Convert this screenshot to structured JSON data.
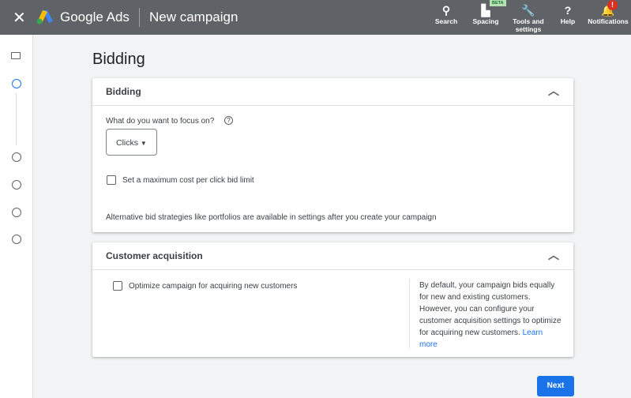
{
  "header": {
    "close": "✕",
    "brand": "Google Ads",
    "title": "New campaign",
    "tools": [
      {
        "label": "Search",
        "icon": "⚲"
      },
      {
        "label": "Spacing",
        "icon": "▙"
      },
      {
        "label": "Tools and settings",
        "icon": "🔧"
      },
      {
        "label": "Help",
        "icon": "?"
      },
      {
        "label": "Notifications",
        "icon": "🔔"
      }
    ],
    "beta": "BETA",
    "badge": "!"
  },
  "page_title": "Bidding",
  "bidding": {
    "header": "Bidding",
    "question": "What do you want to focus on?",
    "help": "?",
    "focus_value": "Clicks",
    "max_cpc_label": "Set a maximum cost per click bid limit",
    "note": "Alternative bid strategies like portfolios are available in settings after you create your campaign"
  },
  "customer": {
    "header": "Customer acquisition",
    "optimize_label": "Optimize campaign for acquiring new customers",
    "help_text": "By default, your campaign bids equally for new and existing customers. However, you can configure your customer acquisition settings to optimize for acquiring new customers.",
    "learn_more": "Learn more"
  },
  "next": "Next"
}
